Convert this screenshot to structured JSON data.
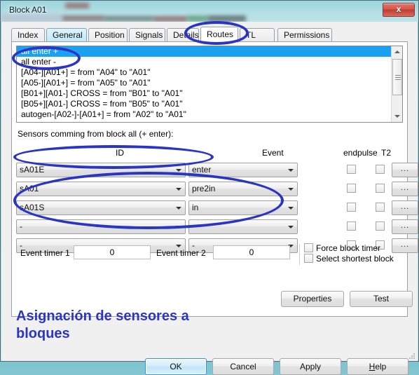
{
  "window": {
    "title": "Block A01",
    "close_label": "x"
  },
  "tabs": [
    {
      "label": "Index",
      "state": "normal"
    },
    {
      "label": "General",
      "state": "hover"
    },
    {
      "label": "Position",
      "state": "normal"
    },
    {
      "label": "Signals",
      "state": "normal"
    },
    {
      "label": "Details",
      "state": "normal"
    },
    {
      "label": "Routes",
      "state": "active"
    },
    {
      "label": "TL",
      "state": "normal"
    },
    {
      "label": "Permissions",
      "state": "normal"
    }
  ],
  "routes_list": [
    {
      "text": "all enter +",
      "selected": true
    },
    {
      "text": "all enter -",
      "selected": false
    },
    {
      "text": "[A04-][A01+] = from \"A04\" to \"A01\"",
      "selected": false
    },
    {
      "text": "[A05-][A01+] = from \"A05\" to \"A01\"",
      "selected": false
    },
    {
      "text": "[B01+][A01-] CROSS = from \"B01\" to \"A01\"",
      "selected": false
    },
    {
      "text": "[B05+][A01-] CROSS = from \"B05\" to \"A01\"",
      "selected": false
    },
    {
      "text": "autogen-[A02-]-[A01+] = from \"A02\" to \"A01\"",
      "selected": false
    }
  ],
  "sensors": {
    "label": "Sensors comming from block all (+ enter):",
    "headers": {
      "id": "ID",
      "event": "Event",
      "endpulse": "endpulse",
      "t2": "T2"
    },
    "dots_label": "...",
    "rows": [
      {
        "id": "sA01E",
        "event": "enter",
        "endpulse": false,
        "t2": false
      },
      {
        "id": "sA01",
        "event": "pre2in",
        "endpulse": false,
        "t2": false
      },
      {
        "id": "sA01S",
        "event": "in",
        "endpulse": false,
        "t2": false
      },
      {
        "id": "-",
        "event": "-",
        "endpulse": false,
        "t2": false
      },
      {
        "id": "-",
        "event": "-",
        "endpulse": false,
        "t2": false
      }
    ]
  },
  "timers": {
    "timer1_label": "Event timer 1",
    "timer1_value": "0",
    "timer2_label": "Event timer 2",
    "timer2_value": "0",
    "force_block_timer": {
      "label": "Force block timer",
      "checked": false
    },
    "select_shortest_block": {
      "label": "Select shortest block",
      "checked": false
    }
  },
  "panel_buttons": {
    "properties": "Properties",
    "test": "Test"
  },
  "footer_buttons": {
    "ok": "OK",
    "cancel": "Cancel",
    "apply": "Apply",
    "help_prefix": "H",
    "help_rest": "elp"
  },
  "annotation": {
    "caption": "Asignación de sensores a bloques",
    "color": "#2b35c4"
  }
}
